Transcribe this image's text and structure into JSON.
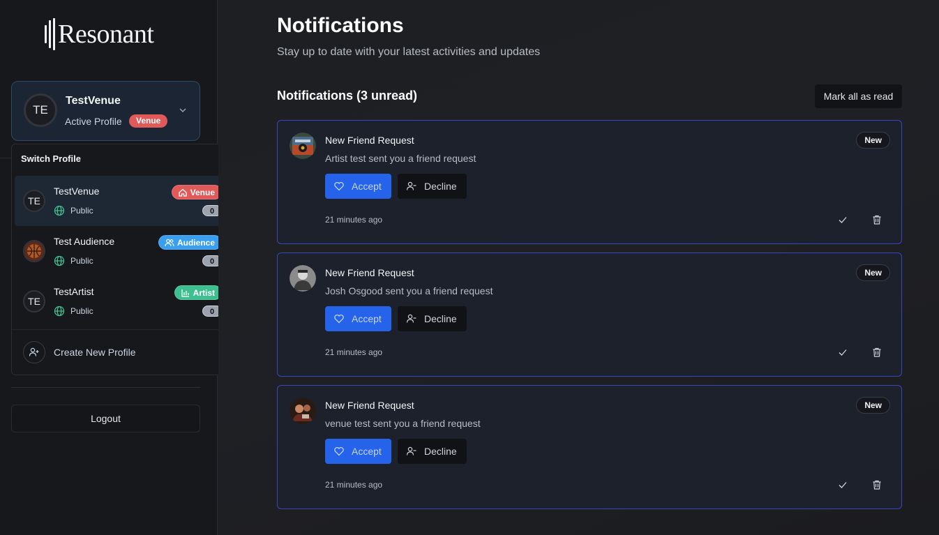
{
  "brand": {
    "name": "Resonant"
  },
  "profile_card": {
    "initials": "TE",
    "name": "TestVenue",
    "subtitle": "Active Profile",
    "badge": "Venue"
  },
  "switcher": {
    "title": "Switch Profile",
    "items": [
      {
        "initials": "TE",
        "name": "TestVenue",
        "visibility": "Public",
        "type": "Venue",
        "count": "0",
        "color": "#e05a5a",
        "active": true
      },
      {
        "initials": "",
        "name": "Test Audience",
        "visibility": "Public",
        "type": "Audience",
        "count": "0",
        "color": "#3b9ff0",
        "active": false
      },
      {
        "initials": "TE",
        "name": "TestArtist",
        "visibility": "Public",
        "type": "Artist",
        "count": "0",
        "color": "#3fbf8f",
        "active": false
      }
    ],
    "create_label": "Create New Profile"
  },
  "logout_label": "Logout",
  "main": {
    "title": "Notifications",
    "subtitle": "Stay up to date with your latest activities and updates",
    "section_title": "Notifications (3 unread)",
    "mark_all_label": "Mark all as read"
  },
  "notifications": [
    {
      "title": "New Friend Request",
      "message": "Artist test sent you a friend request",
      "badge": "New",
      "accept": "Accept",
      "decline": "Decline",
      "time": "21 minutes ago"
    },
    {
      "title": "New Friend Request",
      "message": "Josh Osgood sent you a friend request",
      "badge": "New",
      "accept": "Accept",
      "decline": "Decline",
      "time": "21 minutes ago"
    },
    {
      "title": "New Friend Request",
      "message": "venue test sent you a friend request",
      "badge": "New",
      "accept": "Accept",
      "decline": "Decline",
      "time": "21 minutes ago"
    }
  ],
  "colors": {
    "accent": "#2563eb",
    "card_border": "#3845c0",
    "venue": "#e05a5a",
    "audience": "#3b9ff0",
    "artist": "#3fbf8f"
  }
}
